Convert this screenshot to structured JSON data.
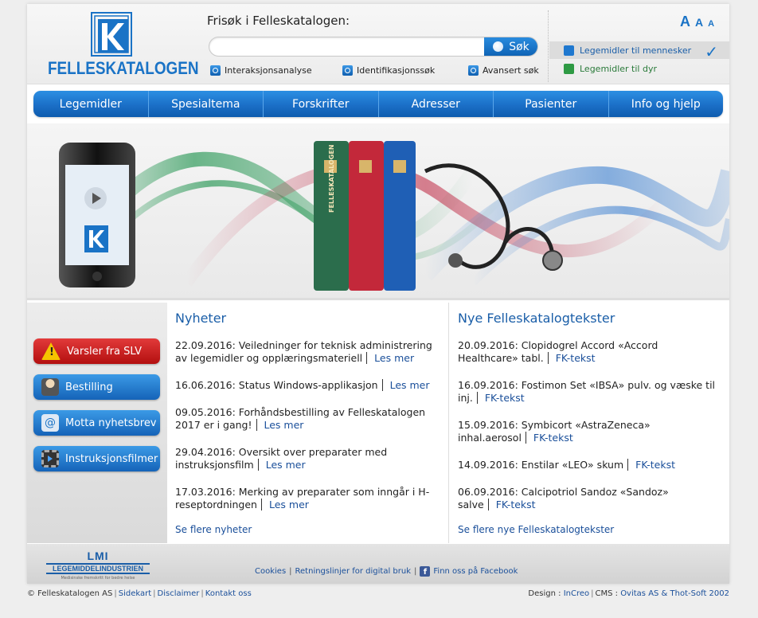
{
  "brand": {
    "name": "FELLESKATALOGEN",
    "logo_letter": "K"
  },
  "search": {
    "label": "Frisøk i Felleskatalogen:",
    "value": "",
    "button": "Søk",
    "links": [
      "Interaksjonsanalyse",
      "Identifikasjonssøk",
      "Avansert søk"
    ]
  },
  "font_size": {
    "large": "A",
    "medium": "A",
    "small": "A"
  },
  "targets": {
    "human": "Legemidler til mennesker",
    "animal": "Legemidler til dyr"
  },
  "nav": [
    "Legemidler",
    "Spesialtema",
    "Forskrifter",
    "Adresser",
    "Pasienter",
    "Info og hjelp"
  ],
  "banner": {
    "book_spine": "FELLESKATALOGEN"
  },
  "sidebar": {
    "buttons": [
      {
        "label": "Varsler fra SLV",
        "icon": "warning-icon",
        "color": "#c8161d"
      },
      {
        "label": "Bestilling",
        "icon": "person-icon",
        "color": "#1f78cf"
      },
      {
        "label": "Motta nyhetsbrev",
        "icon": "email-icon",
        "color": "#1f78cf"
      },
      {
        "label": "Instruksjonsfilmer",
        "icon": "film-icon",
        "color": "#1f78cf"
      }
    ]
  },
  "news": {
    "title": "Nyheter",
    "items": [
      {
        "text": "22.09.2016: Veiledninger for teknisk administrering av legemidler og opplæringsmateriell",
        "link": "Les mer"
      },
      {
        "text": "16.06.2016: Status Windows-applikasjon",
        "link": "Les mer"
      },
      {
        "text": "09.05.2016: Forhåndsbestilling av Felleskatalogen 2017 er i gang!",
        "link": "Les mer"
      },
      {
        "text": "29.04.2016: Oversikt over preparater med instruksjonsfilm",
        "link": "Les mer"
      },
      {
        "text": "17.03.2016: Merking av preparater som inngår i H-reseptordningen",
        "link": "Les mer"
      }
    ],
    "more": "Se flere nyheter"
  },
  "texts": {
    "title": "Nye Felleskatalogtekster",
    "items": [
      {
        "text": "20.09.2016: Clopidogrel Accord «Accord Healthcare» tabl.",
        "link": "FK-tekst"
      },
      {
        "text": "16.09.2016: Fostimon Set «IBSA» pulv. og væske til inj.",
        "link": "FK-tekst"
      },
      {
        "text": "15.09.2016: Symbicort «AstraZeneca» inhal.aerosol",
        "link": "FK-tekst"
      },
      {
        "text": "14.09.2016: Enstilar «LEO» skum",
        "link": "FK-tekst"
      },
      {
        "text": "06.09.2016: Calcipotriol Sandoz «Sandoz» salve",
        "link": "FK-tekst"
      }
    ],
    "more": "Se flere nye Felleskatalogtekster"
  },
  "footer": {
    "lmi": {
      "line1": "LMI",
      "line2": "LEGEMIDDELINDUSTRIEN",
      "line3": "Medisinske fremskritt for bedre helse"
    },
    "links": [
      "Cookies",
      "Retningslinjer for digital bruk",
      "Finn oss på Facebook"
    ]
  },
  "bottom": {
    "copyright": "© Felleskatalogen AS",
    "links": [
      "Sidekart",
      "Disclaimer",
      "Kontakt oss"
    ],
    "design_label": "Design : ",
    "design": "InCreo",
    "cms_label": "CMS : ",
    "cms": "Ovitas AS & Thot-Soft 2002"
  }
}
